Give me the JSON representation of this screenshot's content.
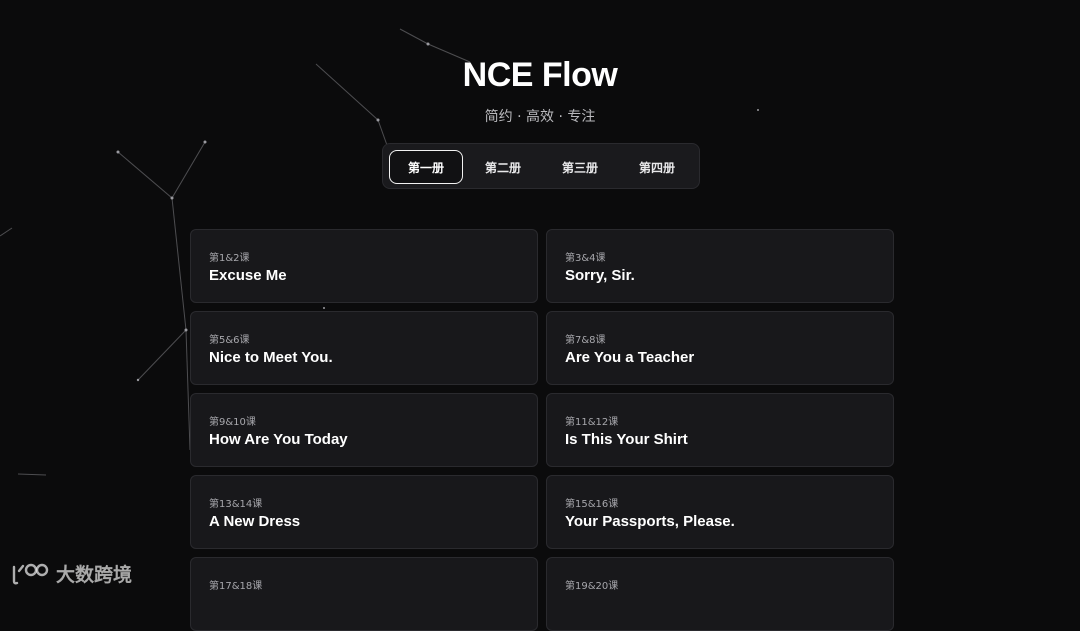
{
  "header": {
    "title": "NCE Flow",
    "subtitle": "简约 · 高效 · 专注"
  },
  "tabs": [
    {
      "label": "第一册",
      "active": true
    },
    {
      "label": "第二册",
      "active": false
    },
    {
      "label": "第三册",
      "active": false
    },
    {
      "label": "第四册",
      "active": false
    }
  ],
  "lessons": [
    {
      "number": "第1&2课",
      "title": "Excuse Me"
    },
    {
      "number": "第3&4课",
      "title": "Sorry, Sir."
    },
    {
      "number": "第5&6课",
      "title": "Nice to Meet You."
    },
    {
      "number": "第7&8课",
      "title": "Are You a Teacher"
    },
    {
      "number": "第9&10课",
      "title": "How Are You Today"
    },
    {
      "number": "第11&12课",
      "title": "Is This Your Shirt"
    },
    {
      "number": "第13&14课",
      "title": "A New Dress"
    },
    {
      "number": "第15&16课",
      "title": "Your Passports, Please."
    },
    {
      "number": "第17&18课",
      "title": ""
    },
    {
      "number": "第19&20课",
      "title": ""
    }
  ],
  "watermark": {
    "text": "大数跨境"
  },
  "colors": {
    "background": "#0b0b0c",
    "card": "#18181b",
    "card_border": "#2a2a2e",
    "muted_text": "#a7a7ac"
  }
}
